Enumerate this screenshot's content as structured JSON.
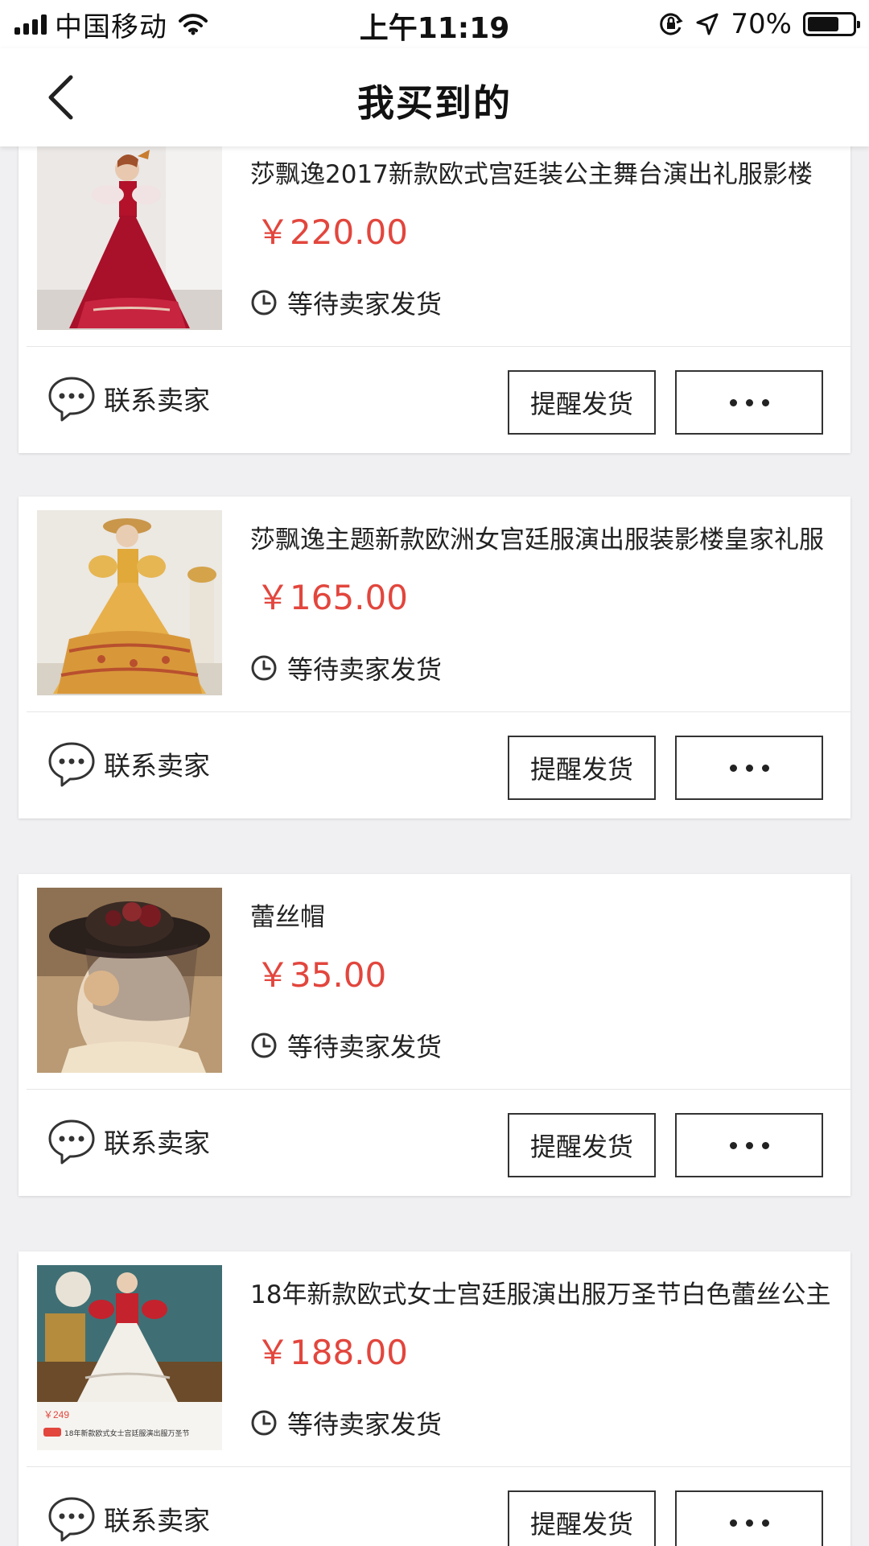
{
  "status_bar": {
    "carrier": "中国移动",
    "time": "上午11:19",
    "battery": "70%",
    "battery_level": 0.7
  },
  "nav": {
    "title": "我买到的",
    "back_icon": "chevron-left-icon"
  },
  "orders": [
    {
      "title": "莎飘逸2017新款欧式宫廷装公主舞台演出礼服影楼",
      "price": "￥220.00",
      "status": "等待卖家发货",
      "image": "red-court-gown",
      "actions": {
        "contact": "联系卖家",
        "remind": "提醒发货"
      }
    },
    {
      "title": "莎飘逸主题新款欧洲女宫廷服演出服装影楼皇家礼服",
      "price": "￥165.00",
      "status": "等待卖家发货",
      "image": "yellow-court-gown",
      "actions": {
        "contact": "联系卖家",
        "remind": "提醒发货"
      }
    },
    {
      "title": "蕾丝帽",
      "price": "￥35.00",
      "status": "等待卖家发货",
      "image": "lace-hat",
      "actions": {
        "contact": "联系卖家",
        "remind": "提醒发货"
      }
    },
    {
      "title": "18年新款欧式女士宫廷服演出服万圣节白色蕾丝公主",
      "price": "￥188.00",
      "status": "等待卖家发货",
      "image": "white-court-gown",
      "thumb_caption": "18年新款欧式女士宫廷服演出服万圣节",
      "thumb_price": "￥249",
      "actions": {
        "contact": "联系卖家",
        "remind": "提醒发货"
      }
    }
  ],
  "colors": {
    "price": "#e2463d",
    "background": "#f0f0f2",
    "card": "#ffffff"
  }
}
